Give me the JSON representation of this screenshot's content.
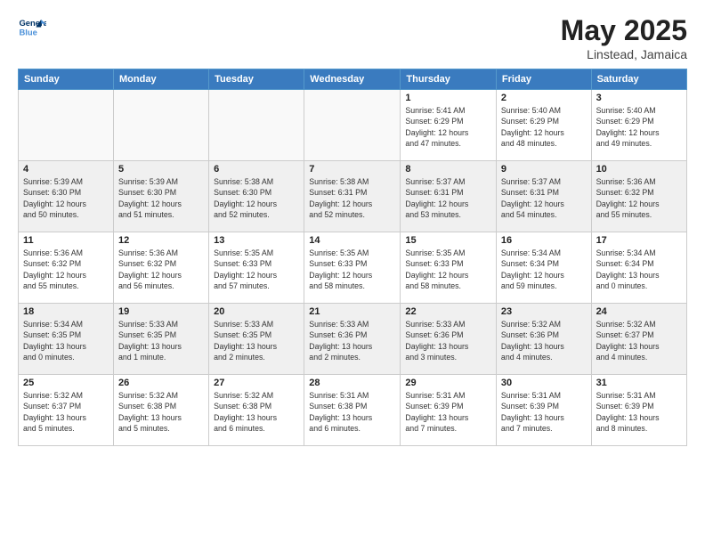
{
  "logo": {
    "line1": "General",
    "line2": "Blue"
  },
  "title": "May 2025",
  "location": "Linstead, Jamaica",
  "days_of_week": [
    "Sunday",
    "Monday",
    "Tuesday",
    "Wednesday",
    "Thursday",
    "Friday",
    "Saturday"
  ],
  "weeks": [
    [
      {
        "day": "",
        "info": ""
      },
      {
        "day": "",
        "info": ""
      },
      {
        "day": "",
        "info": ""
      },
      {
        "day": "",
        "info": ""
      },
      {
        "day": "1",
        "info": "Sunrise: 5:41 AM\nSunset: 6:29 PM\nDaylight: 12 hours\nand 47 minutes."
      },
      {
        "day": "2",
        "info": "Sunrise: 5:40 AM\nSunset: 6:29 PM\nDaylight: 12 hours\nand 48 minutes."
      },
      {
        "day": "3",
        "info": "Sunrise: 5:40 AM\nSunset: 6:29 PM\nDaylight: 12 hours\nand 49 minutes."
      }
    ],
    [
      {
        "day": "4",
        "info": "Sunrise: 5:39 AM\nSunset: 6:30 PM\nDaylight: 12 hours\nand 50 minutes."
      },
      {
        "day": "5",
        "info": "Sunrise: 5:39 AM\nSunset: 6:30 PM\nDaylight: 12 hours\nand 51 minutes."
      },
      {
        "day": "6",
        "info": "Sunrise: 5:38 AM\nSunset: 6:30 PM\nDaylight: 12 hours\nand 52 minutes."
      },
      {
        "day": "7",
        "info": "Sunrise: 5:38 AM\nSunset: 6:31 PM\nDaylight: 12 hours\nand 52 minutes."
      },
      {
        "day": "8",
        "info": "Sunrise: 5:37 AM\nSunset: 6:31 PM\nDaylight: 12 hours\nand 53 minutes."
      },
      {
        "day": "9",
        "info": "Sunrise: 5:37 AM\nSunset: 6:31 PM\nDaylight: 12 hours\nand 54 minutes."
      },
      {
        "day": "10",
        "info": "Sunrise: 5:36 AM\nSunset: 6:32 PM\nDaylight: 12 hours\nand 55 minutes."
      }
    ],
    [
      {
        "day": "11",
        "info": "Sunrise: 5:36 AM\nSunset: 6:32 PM\nDaylight: 12 hours\nand 55 minutes."
      },
      {
        "day": "12",
        "info": "Sunrise: 5:36 AM\nSunset: 6:32 PM\nDaylight: 12 hours\nand 56 minutes."
      },
      {
        "day": "13",
        "info": "Sunrise: 5:35 AM\nSunset: 6:33 PM\nDaylight: 12 hours\nand 57 minutes."
      },
      {
        "day": "14",
        "info": "Sunrise: 5:35 AM\nSunset: 6:33 PM\nDaylight: 12 hours\nand 58 minutes."
      },
      {
        "day": "15",
        "info": "Sunrise: 5:35 AM\nSunset: 6:33 PM\nDaylight: 12 hours\nand 58 minutes."
      },
      {
        "day": "16",
        "info": "Sunrise: 5:34 AM\nSunset: 6:34 PM\nDaylight: 12 hours\nand 59 minutes."
      },
      {
        "day": "17",
        "info": "Sunrise: 5:34 AM\nSunset: 6:34 PM\nDaylight: 13 hours\nand 0 minutes."
      }
    ],
    [
      {
        "day": "18",
        "info": "Sunrise: 5:34 AM\nSunset: 6:35 PM\nDaylight: 13 hours\nand 0 minutes."
      },
      {
        "day": "19",
        "info": "Sunrise: 5:33 AM\nSunset: 6:35 PM\nDaylight: 13 hours\nand 1 minute."
      },
      {
        "day": "20",
        "info": "Sunrise: 5:33 AM\nSunset: 6:35 PM\nDaylight: 13 hours\nand 2 minutes."
      },
      {
        "day": "21",
        "info": "Sunrise: 5:33 AM\nSunset: 6:36 PM\nDaylight: 13 hours\nand 2 minutes."
      },
      {
        "day": "22",
        "info": "Sunrise: 5:33 AM\nSunset: 6:36 PM\nDaylight: 13 hours\nand 3 minutes."
      },
      {
        "day": "23",
        "info": "Sunrise: 5:32 AM\nSunset: 6:36 PM\nDaylight: 13 hours\nand 4 minutes."
      },
      {
        "day": "24",
        "info": "Sunrise: 5:32 AM\nSunset: 6:37 PM\nDaylight: 13 hours\nand 4 minutes."
      }
    ],
    [
      {
        "day": "25",
        "info": "Sunrise: 5:32 AM\nSunset: 6:37 PM\nDaylight: 13 hours\nand 5 minutes."
      },
      {
        "day": "26",
        "info": "Sunrise: 5:32 AM\nSunset: 6:38 PM\nDaylight: 13 hours\nand 5 minutes."
      },
      {
        "day": "27",
        "info": "Sunrise: 5:32 AM\nSunset: 6:38 PM\nDaylight: 13 hours\nand 6 minutes."
      },
      {
        "day": "28",
        "info": "Sunrise: 5:31 AM\nSunset: 6:38 PM\nDaylight: 13 hours\nand 6 minutes."
      },
      {
        "day": "29",
        "info": "Sunrise: 5:31 AM\nSunset: 6:39 PM\nDaylight: 13 hours\nand 7 minutes."
      },
      {
        "day": "30",
        "info": "Sunrise: 5:31 AM\nSunset: 6:39 PM\nDaylight: 13 hours\nand 7 minutes."
      },
      {
        "day": "31",
        "info": "Sunrise: 5:31 AM\nSunset: 6:39 PM\nDaylight: 13 hours\nand 8 minutes."
      }
    ]
  ]
}
